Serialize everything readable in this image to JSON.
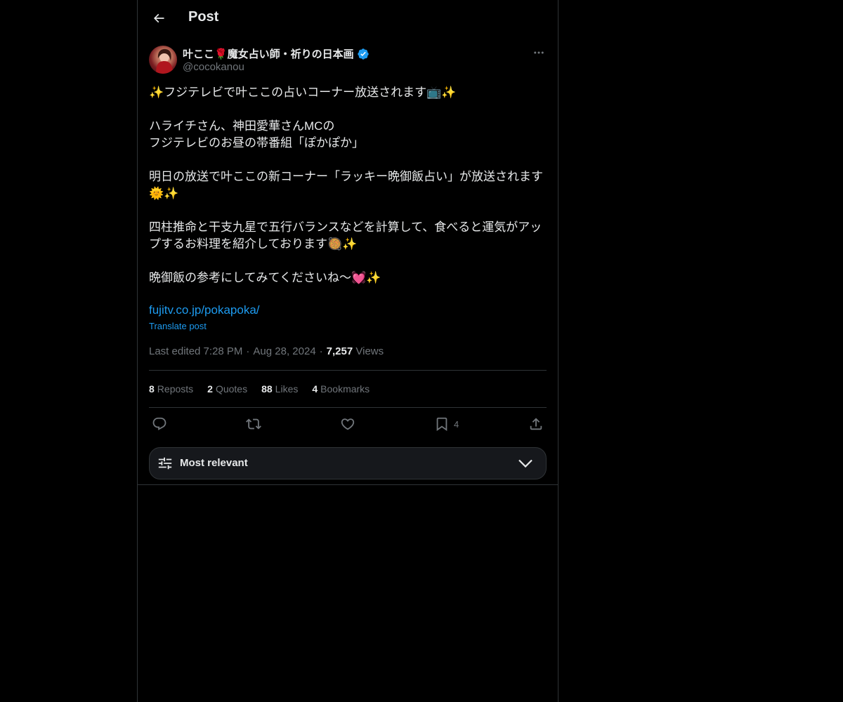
{
  "header": {
    "title": "Post",
    "back_icon": "arrow-left-icon"
  },
  "post": {
    "author": {
      "display_name": "叶ここ🌹魔女占い師・祈りの日本画",
      "handle": "@cocokanou",
      "verified_color": "#1d9bf0"
    },
    "body": "✨フジテレビで叶ここの占いコーナー放送されます📺✨\n\nハライチさん、神田愛華さんMCの\nフジテレビのお昼の帯番組「ぽかぽか」\n\n明日の放送で叶ここの新コーナー「ラッキー晩御飯占い」が放送されます🌞✨\n\n四柱推命と干支九星で五行バランスなどを計算して、食べると運気がアップするお料理を紹介しております🥘✨\n\n晩御飯の参考にしてみてくださいね〜💓✨",
    "link": "fujitv.co.jp/pokapoka/",
    "translate": "Translate post",
    "meta": {
      "edited": "Last edited 7:28 PM",
      "date": "Aug 28, 2024",
      "views_count": "7,257",
      "views_label": "Views"
    },
    "stats": {
      "reposts_count": "8",
      "reposts_label": "Reposts",
      "quotes_count": "2",
      "quotes_label": "Quotes",
      "likes_count": "88",
      "likes_label": "Likes",
      "bookmarks_count": "4",
      "bookmarks_label": "Bookmarks"
    },
    "actions": {
      "bookmark_count": "4"
    }
  },
  "sort": {
    "label": "Most relevant"
  },
  "colors": {
    "background": "#000000",
    "text": "#e7e9ea",
    "muted": "#71767b",
    "accent": "#1d9bf0",
    "border": "#2f3336"
  }
}
